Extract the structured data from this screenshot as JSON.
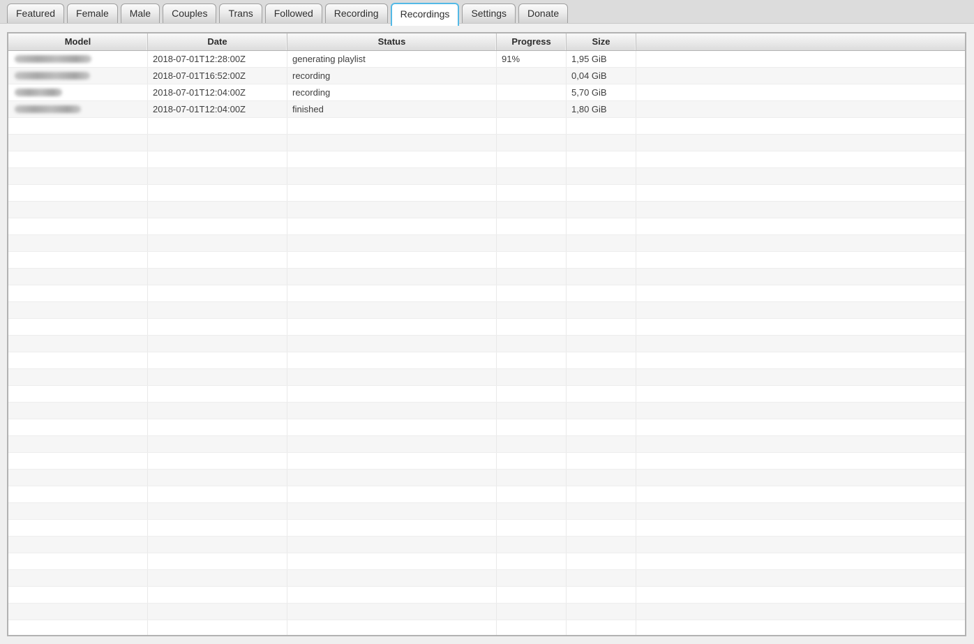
{
  "tabs": {
    "items": [
      {
        "label": "Featured",
        "active": false
      },
      {
        "label": "Female",
        "active": false
      },
      {
        "label": "Male",
        "active": false
      },
      {
        "label": "Couples",
        "active": false
      },
      {
        "label": "Trans",
        "active": false
      },
      {
        "label": "Followed",
        "active": false
      },
      {
        "label": "Recording",
        "active": false
      },
      {
        "label": "Recordings",
        "active": true
      },
      {
        "label": "Settings",
        "active": false
      },
      {
        "label": "Donate",
        "active": false
      }
    ]
  },
  "table": {
    "columns": [
      {
        "label": "Model"
      },
      {
        "label": "Date"
      },
      {
        "label": "Status"
      },
      {
        "label": "Progress"
      },
      {
        "label": "Size"
      },
      {
        "label": ""
      }
    ],
    "rows": [
      {
        "model_redacted": true,
        "model_blur_width": 110,
        "date": "2018-07-01T12:28:00Z",
        "status": "generating playlist",
        "progress": "91%",
        "size": "1,95 GiB"
      },
      {
        "model_redacted": true,
        "model_blur_width": 108,
        "date": "2018-07-01T16:52:00Z",
        "status": "recording",
        "progress": "",
        "size": "0,04 GiB"
      },
      {
        "model_redacted": true,
        "model_blur_width": 68,
        "date": "2018-07-01T12:04:00Z",
        "status": "recording",
        "progress": "",
        "size": "5,70 GiB"
      },
      {
        "model_redacted": true,
        "model_blur_width": 95,
        "date": "2018-07-01T12:04:00Z",
        "status": "finished",
        "progress": "",
        "size": "1,80 GiB"
      }
    ],
    "empty_row_count": 31
  },
  "colors": {
    "active_tab_border": "#54b9e6",
    "row_stripe": "#f6f6f6",
    "header_gradient_top": "#f9f9f9",
    "header_gradient_bottom": "#dcdcdc",
    "table_border": "#b2b2b2",
    "tabbar_background": "#dcdcdc",
    "page_background": "#efefef"
  }
}
